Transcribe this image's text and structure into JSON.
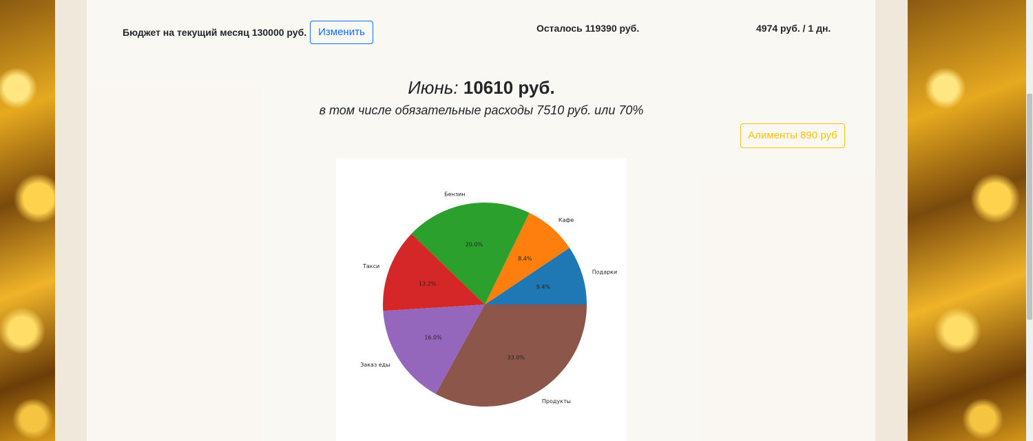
{
  "header": {
    "budget_label": "Бюджет на текущий месяц",
    "budget_value": "130000 руб.",
    "change_button": "Изменить",
    "remaining_label": "Осталось",
    "remaining_value": "119390 руб.",
    "per_day_value": "4974",
    "per_day_unit": "руб. / 1 дн."
  },
  "summary": {
    "month": "Июнь:",
    "total": "10610 руб.",
    "mandatory_text": "в том числе обязательные расходы 7510 руб. или 70%"
  },
  "alimony_button": "Алименты 890 руб",
  "chart_data": {
    "type": "pie",
    "title": "",
    "slices": [
      {
        "label": "Подарки",
        "value": 9.4,
        "pct_label": "9.4%",
        "color": "#1f77b4"
      },
      {
        "label": "Кафе",
        "value": 8.4,
        "pct_label": "8.4%",
        "color": "#ff7f0e"
      },
      {
        "label": "Бензин",
        "value": 20.0,
        "pct_label": "20.0%",
        "color": "#2ca02c"
      },
      {
        "label": "Такси",
        "value": 13.2,
        "pct_label": "13.2%",
        "color": "#d62728"
      },
      {
        "label": "Заказ еды",
        "value": 16.0,
        "pct_label": "16.0%",
        "color": "#9467bd"
      },
      {
        "label": "Продукты",
        "value": 33.0,
        "pct_label": "33.0%",
        "color": "#8c564b"
      }
    ]
  }
}
